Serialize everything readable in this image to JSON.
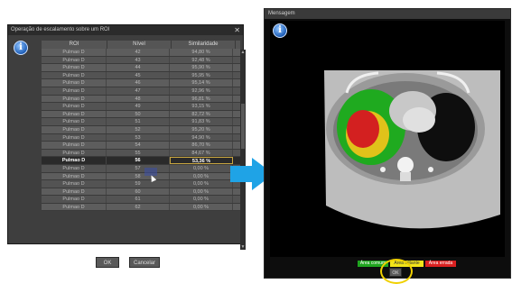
{
  "dialog": {
    "title": "Operação de escalamento sobre um ROI",
    "columns": [
      "ROI",
      "Nível",
      "Similaridade"
    ],
    "rows": [
      [
        "Pulmao D",
        "42",
        "94,80 %"
      ],
      [
        "Pulmao D",
        "43",
        "92,48 %"
      ],
      [
        "Pulmao D",
        "44",
        "95,90 %"
      ],
      [
        "Pulmao D",
        "45",
        "95,95 %"
      ],
      [
        "Pulmao D",
        "46",
        "95,14 %"
      ],
      [
        "Pulmao D",
        "47",
        "92,96 %"
      ],
      [
        "Pulmao D",
        "48",
        "96,81 %"
      ],
      [
        "Pulmao D",
        "49",
        "93,15 %"
      ],
      [
        "Pulmao D",
        "50",
        "82,72 %"
      ],
      [
        "Pulmao D",
        "51",
        "91,83 %"
      ],
      [
        "Pulmao D",
        "52",
        "95,20 %"
      ],
      [
        "Pulmao D",
        "53",
        "94,90 %"
      ],
      [
        "Pulmao D",
        "54",
        "86,70 %"
      ],
      [
        "Pulmao D",
        "55",
        "84,67 %"
      ],
      [
        "Pulmao D",
        "56",
        "53,36 %"
      ],
      [
        "Pulmao D",
        "57",
        "0,00 %"
      ],
      [
        "Pulmao D",
        "58",
        "0,00 %"
      ],
      [
        "Pulmao D",
        "59",
        "0,00 %"
      ],
      [
        "Pulmao D",
        "60",
        "0,00 %"
      ],
      [
        "Pulmao D",
        "61",
        "0,00 %"
      ],
      [
        "Pulmao D",
        "62",
        "0,00 %"
      ]
    ],
    "selected_level": "56",
    "ok_label": "OK",
    "cancel_label": "Cancelar",
    "close_glyph": "✕",
    "info_glyph": "i"
  },
  "message": {
    "title": "Mensagem",
    "info_glyph": "i",
    "legend": [
      {
        "label": "Área comum",
        "color": "#1fa41f",
        "text_color": "#ffffff"
      },
      {
        "label": "Área faltante",
        "color": "#f2e41a",
        "text_color": "#333333"
      },
      {
        "label": "Área errada",
        "color": "#d92020",
        "text_color": "#ffffff"
      }
    ],
    "ok_label": "OK"
  },
  "colors": {
    "arrow": "#1fa3e6",
    "highlight_ring": "#f0d000"
  }
}
